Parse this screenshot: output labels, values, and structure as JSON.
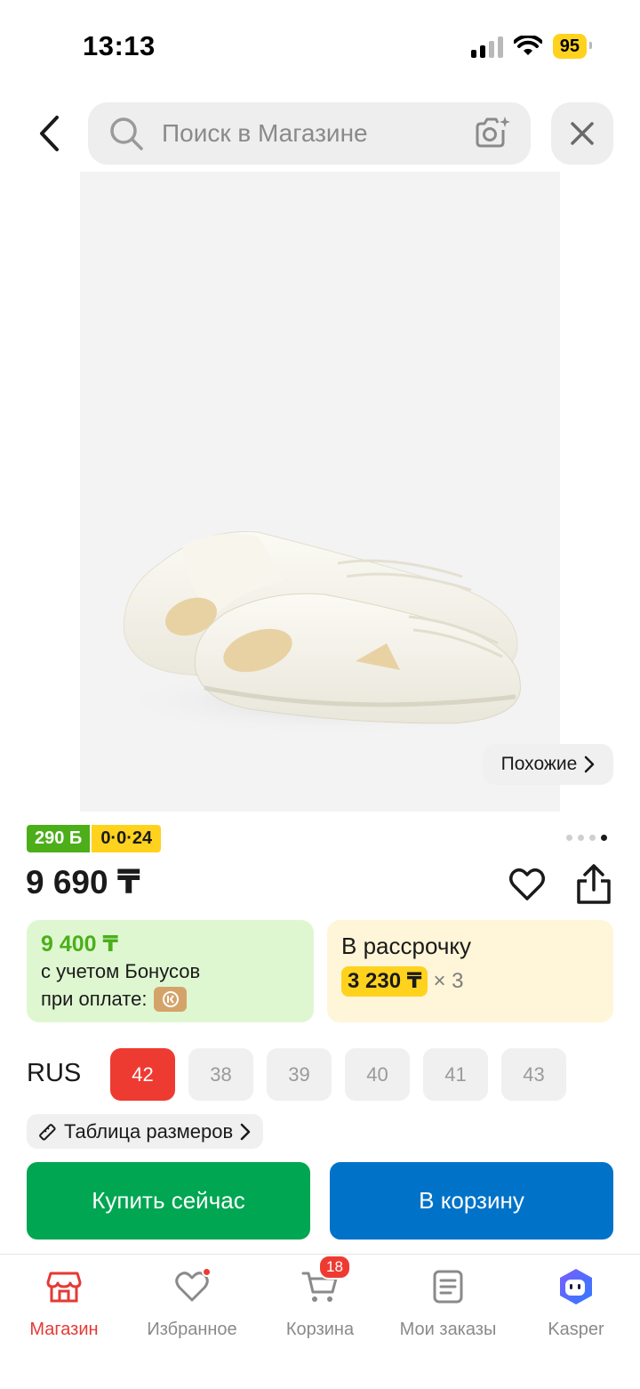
{
  "status_bar": {
    "time": "13:13",
    "battery": "95"
  },
  "search": {
    "placeholder": "Поиск в Магазине"
  },
  "product": {
    "similar_label": "Похожие",
    "bonus_badge": "290 Б",
    "installment_badge": "0·0·24",
    "price": "9 690 ₸",
    "gallery_pages": 4,
    "gallery_active_index": 4
  },
  "bonus_card": {
    "price": "9 400 ₸",
    "line1": "с учетом Бонусов",
    "line2": "при оплате:"
  },
  "installment_card": {
    "title": "В рассрочку",
    "amount": "3 230 ₸",
    "multiplier": "× 3"
  },
  "sizes": {
    "label": "RUS",
    "options": [
      "42",
      "38",
      "39",
      "40",
      "41",
      "43"
    ],
    "selected": "42",
    "table_label": "Таблица размеров"
  },
  "actions": {
    "buy_now": "Купить сейчас",
    "add_to_cart": "В корзину"
  },
  "tab_bar": {
    "items": [
      {
        "label": "Магазин",
        "icon": "shop-icon",
        "active": true
      },
      {
        "label": "Избранное",
        "icon": "heart-icon"
      },
      {
        "label": "Корзина",
        "icon": "cart-icon",
        "badge": "18"
      },
      {
        "label": "Мои заказы",
        "icon": "orders-icon"
      },
      {
        "label": "Kasper",
        "icon": "kasper-assistant-icon"
      }
    ]
  },
  "colors": {
    "accent_red": "#ee3b32",
    "bonus_green": "#4caf1a",
    "installment_yellow": "#ffd21e",
    "buy_green": "#00a651",
    "cart_blue": "#0073c8"
  }
}
